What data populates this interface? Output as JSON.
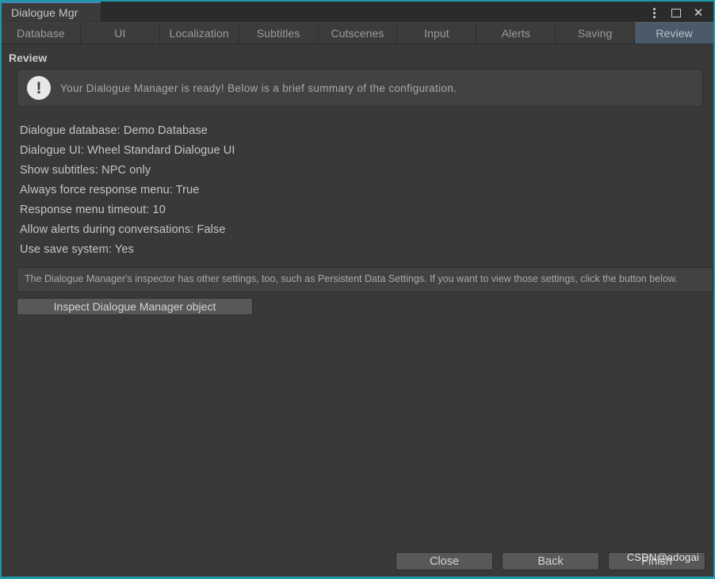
{
  "window": {
    "title": "Dialogue Mgr",
    "controls": [
      {
        "name": "overflow-menu-icon",
        "glyph": "⋮"
      },
      {
        "name": "maximize-icon",
        "glyph": "□"
      },
      {
        "name": "close-icon",
        "glyph": "✕"
      }
    ],
    "accent_color": "#1b9aaa",
    "active_tab_underline_color": "#4a7fb5"
  },
  "tabs": [
    {
      "label": "Database",
      "selected": false
    },
    {
      "label": "UI",
      "selected": false
    },
    {
      "label": "Localization",
      "selected": false
    },
    {
      "label": "Subtitles",
      "selected": false
    },
    {
      "label": "Cutscenes",
      "selected": false
    },
    {
      "label": "Input",
      "selected": false
    },
    {
      "label": "Alerts",
      "selected": false
    },
    {
      "label": "Saving",
      "selected": false
    },
    {
      "label": "Review",
      "selected": true
    }
  ],
  "section": {
    "title": "Review"
  },
  "info": {
    "icon": "speech-bubble-exclamation-icon",
    "glyph": "!",
    "text": "Your Dialogue Manager is ready! Below is a brief summary of the configuration."
  },
  "summary": [
    "Dialogue database: Demo Database",
    "Dialogue UI: Wheel Standard Dialogue UI",
    "Show subtitles: NPC only",
    "Always force response menu: True",
    "Response menu timeout: 10",
    "Allow alerts during conversations: False",
    "Use save system: Yes"
  ],
  "note": {
    "text": "The Dialogue Manager's inspector has other settings, too, such as Persistent Data Settings. If you want to view those settings, click the button below."
  },
  "inspect_button": {
    "label": "Inspect Dialogue Manager object"
  },
  "footer": {
    "close_label": "Close",
    "back_label": "Back",
    "finish_label": "Finish"
  },
  "watermark": {
    "text": "CSDN@adogai"
  }
}
